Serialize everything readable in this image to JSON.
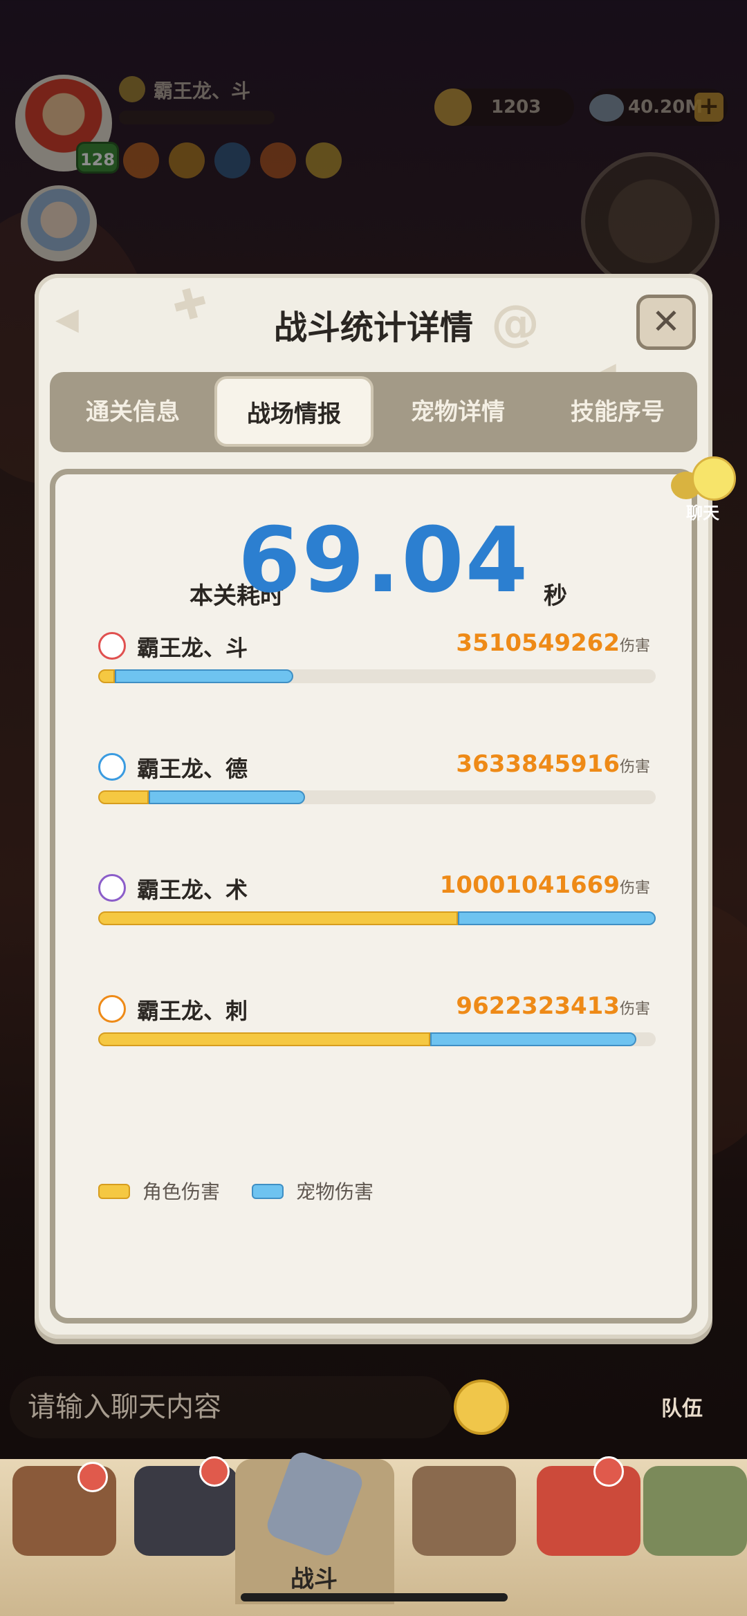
{
  "hud": {
    "player_name": "霸王龙、斗",
    "level": "128",
    "gold": "1203",
    "gems": "40.20M"
  },
  "chat_bubble_label": "聊天",
  "dialog": {
    "title": "战斗统计详情",
    "close_icon": "close-icon",
    "tabs": [
      {
        "label": "通关信息",
        "active": false
      },
      {
        "label": "战场情报",
        "active": true
      },
      {
        "label": "宠物详情",
        "active": false
      },
      {
        "label": "技能序号",
        "active": false
      }
    ],
    "time_label": "本关耗时",
    "time_value": "69.04",
    "time_unit": "秒",
    "damage_unit": "伤害",
    "rows": [
      {
        "name": "霸王龙、斗",
        "icon": "warrior-class-icon",
        "value": "3510549262",
        "char_fraction": 0.03,
        "pet_fraction": 0.32,
        "icon_color": "#e0504f"
      },
      {
        "name": "霸王龙、德",
        "icon": "druid-class-icon",
        "value": "3633845916",
        "char_fraction": 0.09,
        "pet_fraction": 0.28,
        "icon_color": "#3a9be0"
      },
      {
        "name": "霸王龙、术",
        "icon": "warlock-class-icon",
        "value": "10001041669",
        "char_fraction": 0.645,
        "pet_fraction": 0.355,
        "icon_color": "#8b5dc9"
      },
      {
        "name": "霸王龙、刺",
        "icon": "assassin-class-icon",
        "value": "9622323413",
        "char_fraction": 0.595,
        "pet_fraction": 0.37,
        "icon_color": "#ee8a17"
      }
    ],
    "legend": [
      {
        "label": "角色伤害",
        "color": "#f5c842"
      },
      {
        "label": "宠物伤害",
        "color": "#6ec3f0"
      }
    ]
  },
  "chat_input": {
    "placeholder": "请输入聊天内容"
  },
  "team_label": "队伍",
  "bottom_nav": {
    "battle_label": "战斗"
  },
  "colors": {
    "accent_blue": "#2c7fd0",
    "damage_orange": "#ee8a17"
  }
}
